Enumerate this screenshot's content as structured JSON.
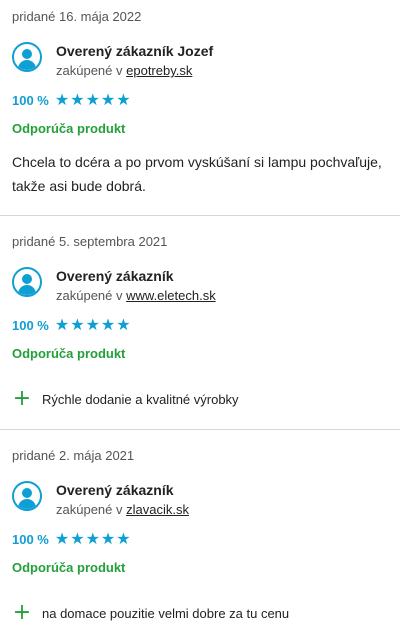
{
  "reviews": [
    {
      "date": "pridané 16. mája 2022",
      "name": "Overený zákazník Jozef",
      "bought_prefix": "zakúpené v",
      "shop": "epotreby.sk",
      "percent": "100 %",
      "stars": 5,
      "recommend": "Odporúča produkt",
      "text": "Chcela to dcéra a po prvom vyskúšaní si lampu pochvaľuje, takže asi bude dobrá."
    },
    {
      "date": "pridané 5. septembra 2021",
      "name": "Overený zákazník",
      "bought_prefix": "zakúpené v",
      "shop": "www.eletech.sk",
      "percent": "100 %",
      "stars": 5,
      "recommend": "Odporúča produkt",
      "pros": [
        "Rýchle dodanie a kvalitné výrobky"
      ]
    },
    {
      "date": "pridané 2. mája 2021",
      "name": "Overený zákazník",
      "bought_prefix": "zakúpené v",
      "shop": "zlavacik.sk",
      "percent": "100 %",
      "stars": 5,
      "recommend": "Odporúča produkt",
      "pros": [
        "na domace pouzitie velmi dobre za tu cenu"
      ]
    }
  ],
  "icons": {
    "avatar": "user-avatar-icon",
    "star": "star-icon",
    "plus": "plus-icon"
  },
  "colors": {
    "accent": "#0e9fd4",
    "recommend": "#23a03a",
    "divider": "#d6d6d6"
  }
}
